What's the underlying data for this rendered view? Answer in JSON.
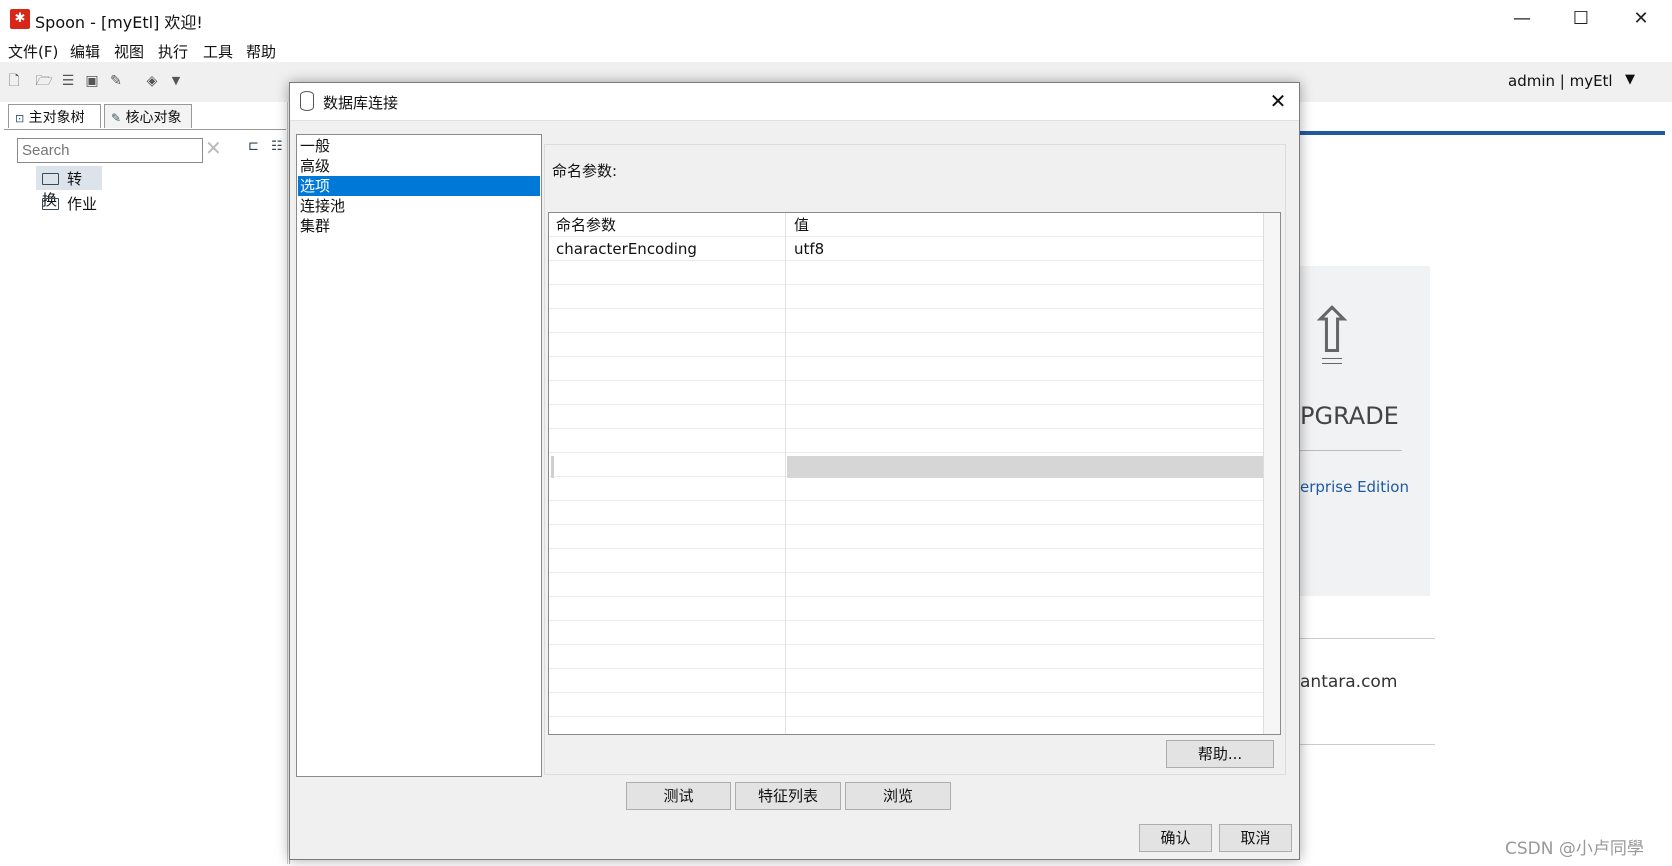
{
  "app": {
    "title": "Spoon - [myEtl] 欢迎!",
    "window_controls": {
      "minimize": "—",
      "maximize": "☐",
      "close": "✕"
    }
  },
  "menubar": [
    "文件(F)",
    "编辑",
    "视图",
    "执行",
    "工具",
    "帮助"
  ],
  "toolbar": {
    "icons": [
      "new-file-icon",
      "open-icon",
      "explore-icon",
      "save-icon",
      "save-as-icon",
      "layers-icon",
      "dropdown-caret-icon"
    ],
    "user_info": "admin  |  myEtl"
  },
  "left_panel": {
    "tabs": [
      "主对象树",
      "核心对象"
    ],
    "search_placeholder": "Search",
    "tree": [
      "转换",
      "作业"
    ]
  },
  "welcome": {
    "upgrade_text": "PGRADE",
    "enterprise_link": "erprise Edition",
    "site_text": "antara.com",
    "watermark": "CSDN @小卢同學"
  },
  "dialog": {
    "title": "数据库连接",
    "nav": [
      {
        "label": "一般",
        "selected": false
      },
      {
        "label": "高级",
        "selected": false
      },
      {
        "label": "选项",
        "selected": true
      },
      {
        "label": "连接池",
        "selected": false
      },
      {
        "label": "集群",
        "selected": false
      }
    ],
    "params_label": "命名参数:",
    "table": {
      "headers": [
        "命名参数",
        "值"
      ],
      "rows": [
        [
          "characterEncoding",
          "utf8"
        ]
      ]
    },
    "buttons": {
      "help": "帮助...",
      "test": "测试",
      "features": "特征列表",
      "browse": "浏览",
      "ok": "确认",
      "cancel": "取消"
    },
    "colors": {
      "selection": "#0078d7",
      "accent": "#1f5aa0"
    }
  }
}
